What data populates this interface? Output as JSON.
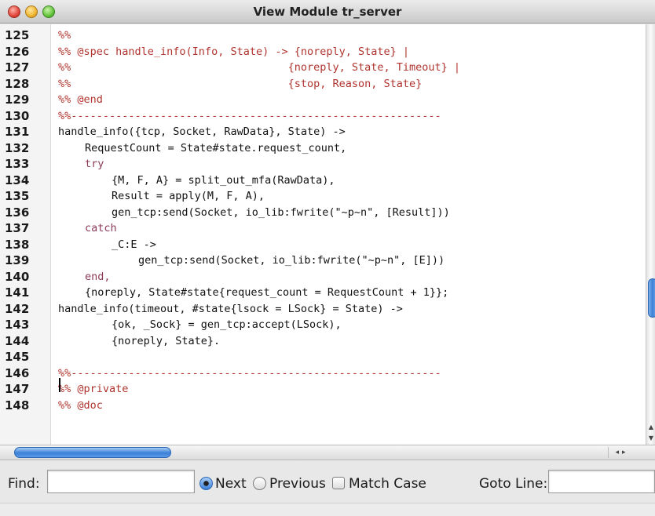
{
  "window": {
    "title": "View Module tr_server"
  },
  "editor": {
    "lines": [
      {
        "num": "125",
        "text": "%%",
        "indent": 0,
        "kind": "comment"
      },
      {
        "num": "126",
        "text": "%% @spec handle_info(Info, State) -> {noreply, State} |",
        "indent": 0,
        "kind": "comment"
      },
      {
        "num": "127",
        "text": "%%                                  {noreply, State, Timeout} |",
        "indent": 0,
        "kind": "comment"
      },
      {
        "num": "128",
        "text": "%%                                  {stop, Reason, State}",
        "indent": 0,
        "kind": "comment"
      },
      {
        "num": "129",
        "text": "%% @end",
        "indent": 0,
        "kind": "comment"
      },
      {
        "num": "130",
        "text": "%%----------------------------------------------------------",
        "indent": 0,
        "kind": "comment"
      },
      {
        "num": "131",
        "text": "handle_info({tcp, Socket, RawData}, State) ->",
        "indent": 0,
        "kind": "code"
      },
      {
        "num": "132",
        "text": "RequestCount = State#state.request_count,",
        "indent": 1,
        "kind": "code"
      },
      {
        "num": "133",
        "text": "try",
        "indent": 1,
        "kind": "kw"
      },
      {
        "num": "134",
        "text": "{M, F, A} = split_out_mfa(RawData),",
        "indent": 2,
        "kind": "code"
      },
      {
        "num": "135",
        "text": "Result = apply(M, F, A),",
        "indent": 2,
        "kind": "code"
      },
      {
        "num": "136",
        "text": "gen_tcp:send(Socket, io_lib:fwrite(\"~p~n\", [Result]))",
        "indent": 2,
        "kind": "code"
      },
      {
        "num": "137",
        "text": "catch",
        "indent": 1,
        "kind": "kw"
      },
      {
        "num": "138",
        "text": "_C:E ->",
        "indent": 2,
        "kind": "code"
      },
      {
        "num": "139",
        "text": "gen_tcp:send(Socket, io_lib:fwrite(\"~p~n\", [E]))",
        "indent": 3,
        "kind": "code"
      },
      {
        "num": "140",
        "text": "end,",
        "indent": 1,
        "kind": "kw"
      },
      {
        "num": "141",
        "text": "{noreply, State#state{request_count = RequestCount + 1}};",
        "indent": 1,
        "kind": "code"
      },
      {
        "num": "142",
        "text": "handle_info(timeout, #state{lsock = LSock} = State) ->",
        "indent": 0,
        "kind": "code"
      },
      {
        "num": "143",
        "text": "{ok, _Sock} = gen_tcp:accept(LSock),",
        "indent": 2,
        "kind": "code"
      },
      {
        "num": "144",
        "text": "{noreply, State}.",
        "indent": 2,
        "kind": "code"
      },
      {
        "num": "145",
        "text": "",
        "indent": 0,
        "kind": "code"
      },
      {
        "num": "146",
        "text": "%%----------------------------------------------------------",
        "indent": 0,
        "kind": "comment"
      },
      {
        "num": "147",
        "text": "%% @private",
        "indent": 0,
        "kind": "comment"
      },
      {
        "num": "148",
        "text": "%% @doc",
        "indent": 0,
        "kind": "comment"
      }
    ]
  },
  "findbar": {
    "find_label": "Find:",
    "find_value": "",
    "next_label": "Next",
    "next_selected": true,
    "previous_label": "Previous",
    "match_case_label": "Match Case",
    "match_case_checked": false,
    "goto_label": "Goto Line:",
    "goto_value": ""
  },
  "colors": {
    "comment": "#b0352e",
    "keyword": "#8b3a5a",
    "code": "#111111",
    "scroll_accent": "#3a80d8"
  }
}
